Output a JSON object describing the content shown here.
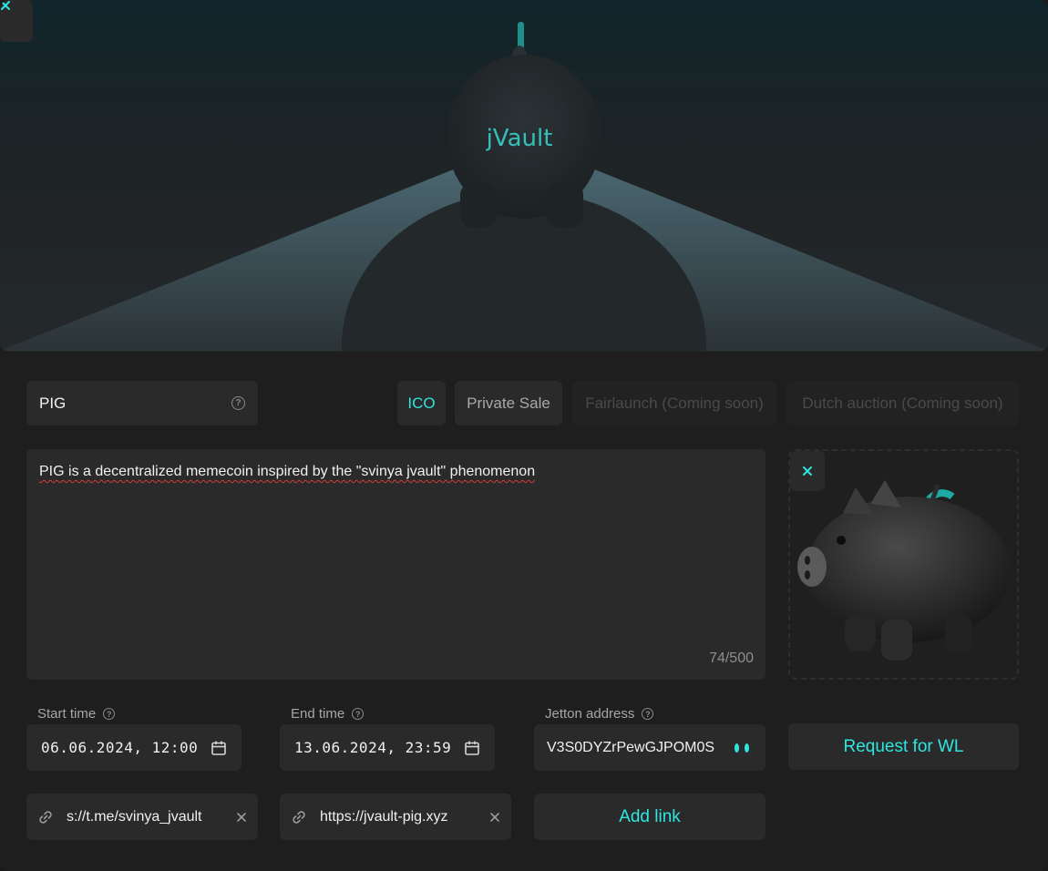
{
  "banner": {
    "brand_text": "jVault"
  },
  "token": {
    "name_value": "PIG"
  },
  "sale_types": [
    {
      "label": "ICO",
      "state": "active"
    },
    {
      "label": "Private Sale",
      "state": "normal"
    },
    {
      "label": "Fairlaunch (Coming soon)",
      "state": "disabled"
    },
    {
      "label": "Dutch auction (Coming soon)",
      "state": "disabled"
    }
  ],
  "description": {
    "value": "PIG is a decentralized memecoin inspired by the \"svinya jvault\" phenomenon",
    "counter": "74/500"
  },
  "schedule": {
    "start_label": "Start time",
    "start_value": "06.06.2024, 12:00",
    "end_label": "End time",
    "end_value": "13.06.2024, 23:59"
  },
  "jetton": {
    "label": "Jetton address",
    "value": "V3S0DYZrPewGJPOM0S"
  },
  "buttons": {
    "request_wl": "Request for WL",
    "add_link": "Add link"
  },
  "links": [
    {
      "value": "s://t.me/svinya_jvault"
    },
    {
      "value": "https://jvault-pig.xyz"
    }
  ],
  "colors": {
    "accent": "#2ee6e0",
    "panel": "#1e1e1e",
    "field": "#2a2a2a"
  },
  "icons": [
    "close-icon",
    "help-icon",
    "calendar-icon",
    "link-icon",
    "clear-icon"
  ]
}
